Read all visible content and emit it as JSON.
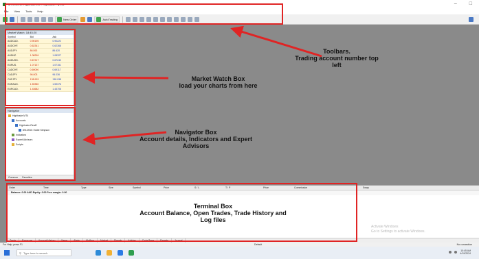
{
  "window": {
    "title": "MT4 Demo: Hightrade.exe - Hightrade Pty Ltd",
    "controls": [
      "–",
      "□"
    ]
  },
  "menu": [
    "File",
    "View",
    "Tools",
    "Help"
  ],
  "toolbar": {
    "new_order_label": "New Order",
    "auto_trading_label": "AutoTrading"
  },
  "market_watch": {
    "title": "Market Watch: 18:45:20",
    "columns": [
      "Symbol",
      "Bid",
      "Ask"
    ],
    "rows": [
      {
        "symbol": "AUDCAD.",
        "bid": "0.90195",
        "ask": "0.90222"
      },
      {
        "symbol": "AUDCHF.",
        "bid": "0.62341",
        "ask": "0.62368"
      },
      {
        "symbol": "AUDJPY.",
        "bid": "86.592",
        "ask": "86.620"
      },
      {
        "symbol": "AUDNZ.",
        "bid": "1.08299",
        "ask": "1.08327"
      },
      {
        "symbol": "AUDUSD.",
        "bid": "0.67217",
        "ask": "0.67240"
      },
      {
        "symbol": "EURUS.",
        "bid": "1.07137",
        "ask": "1.07151"
      },
      {
        "symbol": "CADCHF.",
        "bid": "0.69090",
        "ask": "0.69117"
      },
      {
        "symbol": "CADJPY.",
        "bid": "96.003",
        "ask": "96.036"
      },
      {
        "symbol": "CHFJPY.",
        "bid": "138.903",
        "ask": "138.938"
      },
      {
        "symbol": "EURAUD.",
        "bid": "1.59350",
        "ask": "1.59376"
      },
      {
        "symbol": "EURCAD.",
        "bid": "1.43682",
        "ask": "1.43708"
      }
    ]
  },
  "navigator": {
    "title": "Navigator",
    "items": [
      {
        "label": "Hightrade MT4",
        "level": 0
      },
      {
        "label": "Accounts",
        "level": 1
      },
      {
        "label": "Hightrade-Real2",
        "level": 2
      },
      {
        "label": "8914933: Eddie Simpson",
        "level": 3
      },
      {
        "label": "Indicators",
        "level": 1
      },
      {
        "label": "Expert Advisors",
        "level": 1
      },
      {
        "label": "Scripts",
        "level": 1
      }
    ],
    "tabs": [
      "Common",
      "Favorites"
    ]
  },
  "terminal": {
    "columns": [
      "Order",
      "Time",
      "Type",
      "Size",
      "Symbol",
      "Price",
      "S / L",
      "T / P",
      "Price",
      "Commission",
      "Swap"
    ],
    "balance_line": "Balance: 0.00 AUD  Equity: 0.00  Free margin: 0.00",
    "tabs": [
      "Trade",
      "Exposure",
      "Account History",
      "News",
      "Alerts",
      "Mailbox",
      "Market",
      "Signals",
      "Articles",
      "Code Base",
      "Experts",
      "Journal"
    ]
  },
  "statusbar": {
    "left": "For Help, press F1",
    "mid": "Default",
    "right": "No connection"
  },
  "watermark": {
    "line1": "Activate Windows",
    "line2": "Go to Settings to activate Windows."
  },
  "taskbar": {
    "search_placeholder": "Type here to search",
    "time": "10:45 AM",
    "date": "4/19/2024"
  },
  "annotations": {
    "toolbars": "Toolbars.\nTrading account number top left",
    "market_watch": "Market Watch Box\nload your charts from here",
    "navigator": "Navigator Box\nAccount details, Indicators and Expert Advisors",
    "terminal": "Terminal Box\nAccount Balance, Open Trades, Trade History and Log files"
  },
  "colors": {
    "annotation_red": "#e02424",
    "chart_bg": "#8a8a8a",
    "market_watch_row": "#fff7d6"
  }
}
